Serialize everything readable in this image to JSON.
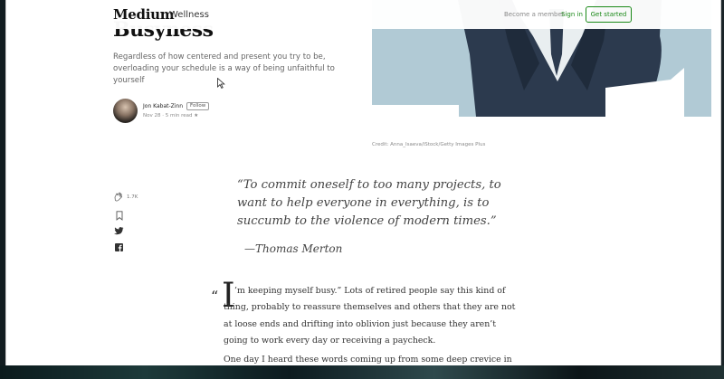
{
  "header": {
    "logo": "Medium",
    "section": "Wellness",
    "become_member": "Become a member",
    "sign_in": "Sign in",
    "get_started": "Get started"
  },
  "article": {
    "title": "Busyness",
    "subtitle": "Regardless of how centered and present you try to be, overloading your schedule is a way of being unfaithful to yourself",
    "author": "Jon Kabat-Zinn",
    "follow": "Follow",
    "meta": "Nov 28 · 5 min read ★",
    "image_credit": "Credit: Anna_Isaeva/iStock/Getty Images Plus"
  },
  "share": {
    "clap_count": "1.7K",
    "icons": [
      "clap-icon",
      "bookmark-icon",
      "twitter-icon",
      "facebook-icon"
    ]
  },
  "quote": {
    "text": "“To commit oneself to too many projects, to want to help everyone in everything, is to succumb to the violence of modern times.”",
    "author": "—Thomas Merton"
  },
  "body": {
    "dropcap_quote": "“",
    "dropcap": "I",
    "para1_rest": "’m keeping myself busy.” Lots of retired people say this kind of thing, probably to reassure themselves and others that they are not at loose ends and drifting into oblivion just because they aren’t going to work every day or receiving a paycheck.",
    "para2": "One day I heard these words coming up from some deep crevice in my own"
  },
  "colors": {
    "accent_green": "#1a8917",
    "hero_bg": "#b1cad5",
    "suit_navy": "#2c3a4e"
  }
}
